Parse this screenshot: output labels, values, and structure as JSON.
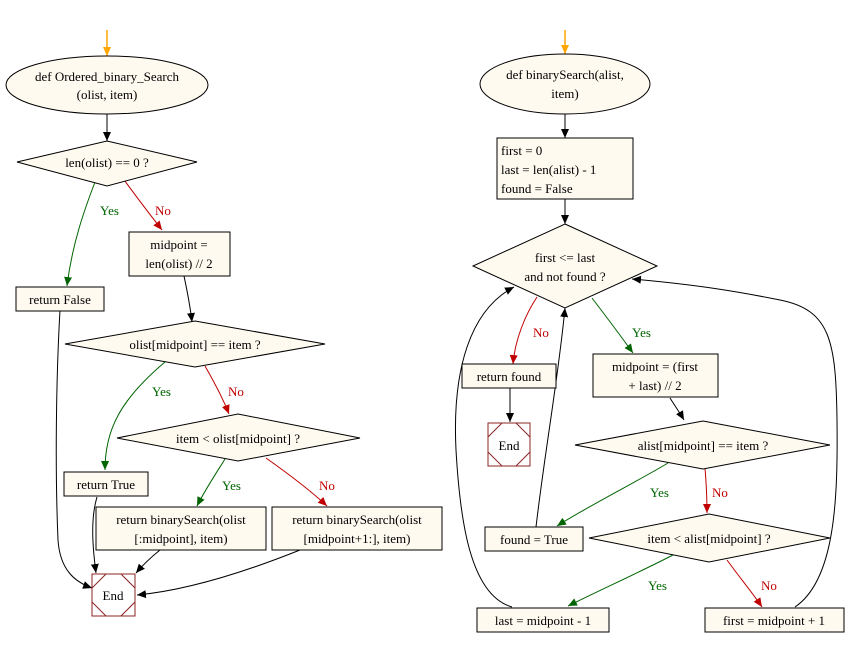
{
  "colors": {
    "node_fill": "#fffaf0",
    "start_arrow": "#ffa500",
    "yes_edge": "#006400",
    "no_edge": "#c00000",
    "end_border": "#8b2323"
  },
  "left_flow": {
    "start": {
      "line1": "def Ordered_binary_Search",
      "line2": "(olist, item)"
    },
    "check_empty": "len(olist) == 0 ?",
    "return_false": "return False",
    "midpoint": {
      "line1": "midpoint =",
      "line2": "len(olist) // 2"
    },
    "check_equal": "olist[midpoint] == item ?",
    "return_true": "return True",
    "check_less": "item < olist[midpoint] ?",
    "recurse_left": {
      "line1": "return binarySearch(olist",
      "line2": "[:midpoint], item)"
    },
    "recurse_right": {
      "line1": "return binarySearch(olist",
      "line2": "[midpoint+1:], item)"
    },
    "end": "End",
    "labels": {
      "yes": "Yes",
      "no": "No"
    }
  },
  "right_flow": {
    "start": {
      "line1": "def binarySearch(alist,",
      "line2": "item)"
    },
    "init": {
      "line1": "first = 0",
      "line2": "last = len(alist) - 1",
      "line3": "found = False"
    },
    "loop_check": {
      "line1": "first <= last",
      "line2": "and not found ?"
    },
    "return_found": "return found",
    "end": "End",
    "midpoint": {
      "line1": "midpoint = (first",
      "line2": "+ last) // 2"
    },
    "check_equal": "alist[midpoint] == item ?",
    "found_true": "found = True",
    "check_less": "item < alist[midpoint] ?",
    "set_last": "last = midpoint - 1",
    "set_first": "first = midpoint + 1",
    "labels": {
      "yes": "Yes",
      "no": "No"
    }
  }
}
